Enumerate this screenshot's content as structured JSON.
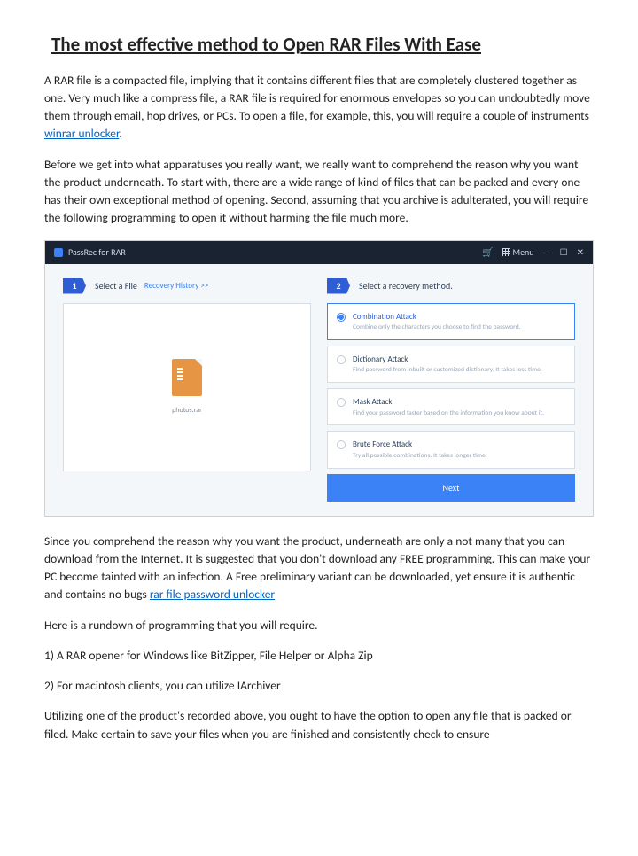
{
  "title": "The most effective method to Open RAR Files With Ease",
  "p1a": "A RAR file is a compacted file, implying that it contains different files that are completely clustered together as one. Very much like a compress file, a RAR file is required for enormous envelopes so you can undoubtedly move them through email, hop drives, or PCs. To open a file, for example, this, you will require a couple of instruments ",
  "link1": "winrar unlocker",
  "p1b": ".",
  "p2": "Before we get into what apparatuses you really want, we really want to comprehend the reason why you want the product underneath. To start with, there are a wide range of kind of files that can be packed and every one has their own exceptional method of opening. Second, assuming that you archive is adulterated, you will require the following programming to open it without harming the file much more.",
  "p3a": "Since you comprehend the reason why you want the product, underneath are only a not many that you can download from the Internet. It is suggested that you don't download any FREE programming. This can make your PC become tainted with an infection. A Free preliminary variant can be downloaded, yet ensure it is authentic and contains no bugs ",
  "link2": "rar file password unlocker",
  "p4": "Here is a rundown of programming that you will require.",
  "p5": "1) A RAR opener for Windows like BitZipper, File Helper or Alpha Zip",
  "p6": "2) For macintosh clients, you can utilize IArchiver",
  "p7": "Utilizing one of the product's recorded above, you ought to have the option to open any file that is packed or filed. Make certain to save your files when you are finished and consistently check to ensure",
  "app": {
    "name": "PassRec for RAR",
    "menu": "Menu",
    "step1": {
      "num": "1",
      "title": "Select a File",
      "link": "Recovery History >>",
      "filename": "photos.rar"
    },
    "step2": {
      "num": "2",
      "title": "Select a recovery method.",
      "opts": [
        {
          "t": "Combination Attack",
          "d": "Combine only the characters you choose to find the password."
        },
        {
          "t": "Dictionary Attack",
          "d": "Find password from inbuilt or customized dictionary. It takes less time."
        },
        {
          "t": "Mask Attack",
          "d": "Find your password faster based on the information you know about it."
        },
        {
          "t": "Brute Force Attack",
          "d": "Try all possible combinations. It takes longer time."
        }
      ],
      "next": "Next"
    }
  }
}
